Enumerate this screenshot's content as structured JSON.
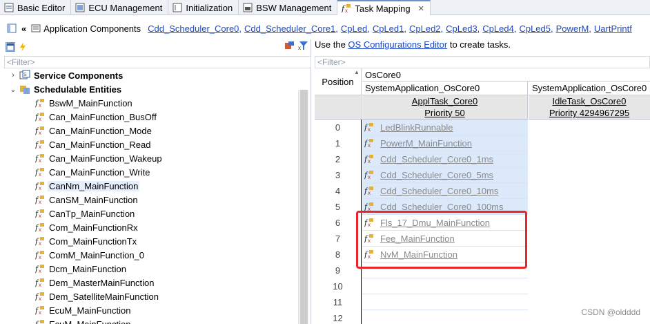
{
  "tabs": [
    {
      "label": "Basic Editor",
      "icon": "basic-editor-icon",
      "active": false
    },
    {
      "label": "ECU Management",
      "icon": "ecu-management-icon",
      "active": false
    },
    {
      "label": "Initialization",
      "icon": "initialization-icon",
      "active": false
    },
    {
      "label": "BSW Management",
      "icon": "bsw-management-icon",
      "active": false
    },
    {
      "label": "Task Mapping",
      "icon": "function-icon",
      "active": true,
      "close": "✕"
    }
  ],
  "breadcrumb": {
    "collapse_glyph": "«",
    "root": "Application Components",
    "links": [
      "Cdd_Scheduler_Core0,",
      "Cdd_Scheduler_Core1,",
      "CpLed,",
      "CpLed1,",
      "CpLed2,",
      "CpLed3,",
      "CpLed4,",
      "CpLed5,",
      "PowerM,",
      "UartPrintf"
    ]
  },
  "left_panel": {
    "filter_placeholder": "<Filter>",
    "tree": [
      {
        "label": "Service Components",
        "bold": true,
        "expanded": false,
        "chevron": "›"
      },
      {
        "label": "Schedulable Entities",
        "bold": true,
        "expanded": true,
        "chevron": "⌄"
      },
      {
        "label": "BswM_MainFunction"
      },
      {
        "label": "Can_MainFunction_BusOff"
      },
      {
        "label": "Can_MainFunction_Mode"
      },
      {
        "label": "Can_MainFunction_Read"
      },
      {
        "label": "Can_MainFunction_Wakeup"
      },
      {
        "label": "Can_MainFunction_Write"
      },
      {
        "label": "CanNm_MainFunction",
        "selected": true
      },
      {
        "label": "CanSM_MainFunction"
      },
      {
        "label": "CanTp_MainFunction"
      },
      {
        "label": "Com_MainFunctionRx"
      },
      {
        "label": "Com_MainFunctionTx"
      },
      {
        "label": "ComM_MainFunction_0"
      },
      {
        "label": "Dcm_MainFunction"
      },
      {
        "label": "Dem_MasterMainFunction"
      },
      {
        "label": "Dem_SatelliteMainFunction"
      },
      {
        "label": "EcuM_MainFunction"
      },
      {
        "label": "EcuM_MainFunction"
      }
    ]
  },
  "right_panel": {
    "info_prefix": "Use the ",
    "info_link": "OS Configurations Editor",
    "info_suffix": " to create tasks.",
    "filter_placeholder": "<Filter>",
    "position_header": "Position",
    "core_header": "OsCore0",
    "app1": "SystemApplication_OsCore0",
    "app2": "SystemApplication_OsCore0",
    "task1": {
      "name": "ApplTask_Core0",
      "priority": "Priority 50"
    },
    "task2": {
      "name": "IdleTask_OsCore0",
      "priority": "Priority 4294967295"
    },
    "rows": [
      {
        "pos": "0",
        "runnable": "LedBlinkRunnable",
        "state": "filled"
      },
      {
        "pos": "1",
        "runnable": "PowerM_MainFunction",
        "state": "filled"
      },
      {
        "pos": "2",
        "runnable": "Cdd_Scheduler_Core0_1ms",
        "state": "filled"
      },
      {
        "pos": "3",
        "runnable": "Cdd_Scheduler_Core0_5ms",
        "state": "filled"
      },
      {
        "pos": "4",
        "runnable": "Cdd_Scheduler_Core0_10ms",
        "state": "filled"
      },
      {
        "pos": "5",
        "runnable": "Cdd_Scheduler_Core0_100ms",
        "state": "filled"
      },
      {
        "pos": "6",
        "runnable": "Fls_17_Dmu_MainFunction",
        "state": "mapped"
      },
      {
        "pos": "7",
        "runnable": "Fee_MainFunction",
        "state": "mapped"
      },
      {
        "pos": "8",
        "runnable": "NvM_MainFunction",
        "state": "mapped"
      },
      {
        "pos": "9",
        "runnable": "",
        "state": "empty"
      },
      {
        "pos": "10",
        "runnable": "",
        "state": "empty"
      },
      {
        "pos": "11",
        "runnable": "",
        "state": "empty"
      },
      {
        "pos": "12",
        "runnable": "",
        "state": "empty"
      }
    ]
  },
  "watermark": "CSDN @oldddd",
  "colors": {
    "link": "#1b47c7",
    "selection": "#dce9fb",
    "highlight_box": "#e8262a"
  }
}
